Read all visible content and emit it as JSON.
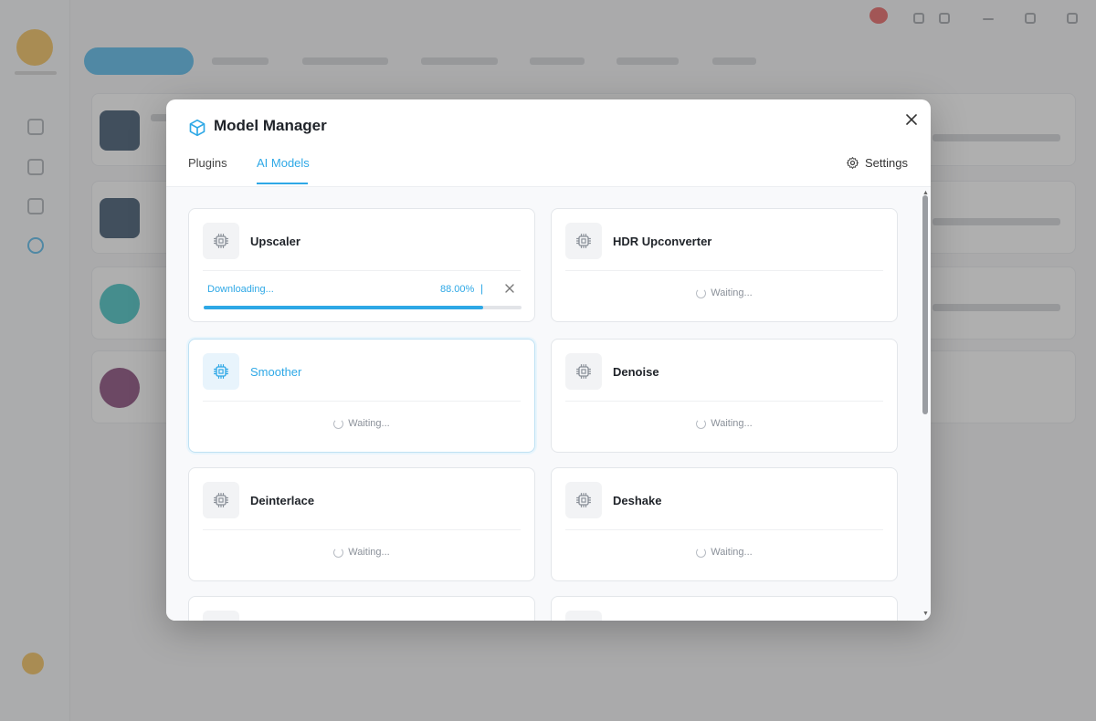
{
  "modal": {
    "title": "Model Manager",
    "tabs": [
      {
        "label": "Plugins",
        "active": false
      },
      {
        "label": "AI Models",
        "active": true
      }
    ],
    "settings_label": "Settings",
    "accent_color": "#2ea8e6",
    "models": [
      {
        "name": "Upscaler",
        "status": "downloading",
        "status_text": "Downloading...",
        "progress_text": "88.00%",
        "progress": 0.88
      },
      {
        "name": "HDR Upconverter",
        "status": "waiting",
        "status_text": "Waiting..."
      },
      {
        "name": "Smoother",
        "status": "waiting",
        "status_text": "Waiting...",
        "selected": true
      },
      {
        "name": "Denoise",
        "status": "waiting",
        "status_text": "Waiting..."
      },
      {
        "name": "Deinterlace",
        "status": "waiting",
        "status_text": "Waiting..."
      },
      {
        "name": "Deshake",
        "status": "waiting",
        "status_text": "Waiting..."
      }
    ],
    "model_icon": "chip-icon"
  }
}
